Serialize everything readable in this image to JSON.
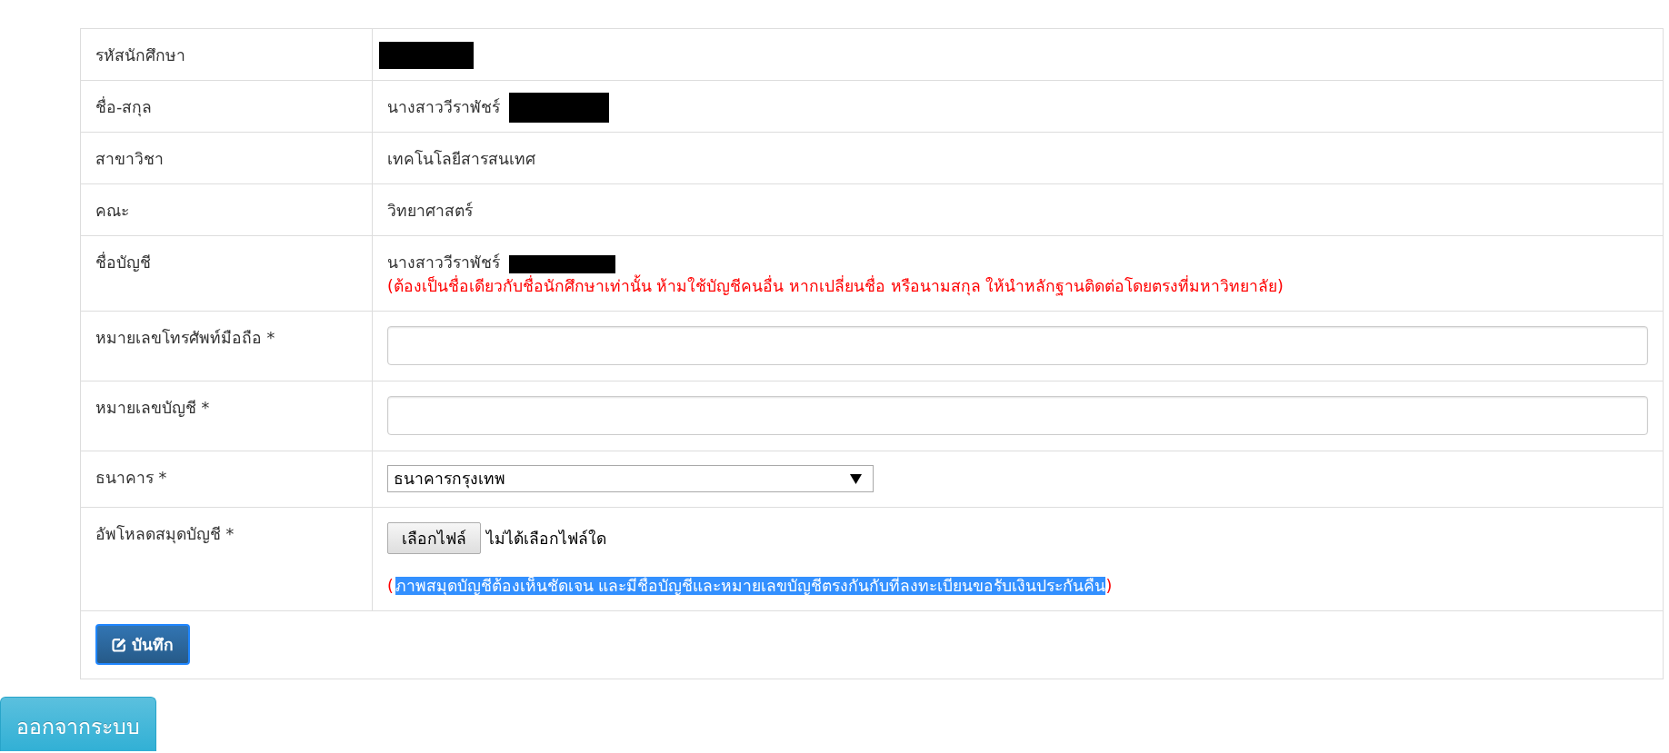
{
  "form": {
    "rows": [
      {
        "kind": "text",
        "label": "รหัสนักศึกษา",
        "redacted": true
      },
      {
        "kind": "text",
        "label": "ชื่อ-สกุล",
        "value": "นางสาววีราพัชร์",
        "redacted": true
      },
      {
        "kind": "text",
        "label": "สาขาวิชา",
        "value": "เทคโนโลยีสารสนเทศ",
        "redacted": false
      },
      {
        "kind": "text",
        "label": "คณะ",
        "value": "วิทยาศาสตร์",
        "redacted": false
      },
      {
        "kind": "text",
        "label": "ชื่อบัญชี",
        "value": "นางสาววีราพัชร์",
        "redacted": true,
        "note": "(ต้องเป็นชื่อเดียวกับชื่อนักศึกษาเท่านั้น ห้ามใช้บัญชีคนอื่น หากเปลี่ยนชื่อ หรือนามสกุล ให้นำหลักฐานติดต่อโดยตรงที่มหาวิทยาลัย)"
      },
      {
        "kind": "input",
        "label": "หมายเลขโทรศัพท์มือถือ *"
      },
      {
        "kind": "input",
        "label": "หมายเลขบัญชี *"
      },
      {
        "kind": "select",
        "label": "ธนาคาร *",
        "value": "ธนาคารกรุงเทพ"
      },
      {
        "kind": "file",
        "label": "อัพโหลดสมุดบัญชี *",
        "button": "เลือกไฟล์",
        "status": "ไม่ได้เลือกไฟล์ใด",
        "note": {
          "prefix": "(",
          "text": "ภาพสมุดบัญชีต้องเห็นชัดเจน และมีชื่อบัญชีและหมายเลขบัญชีตรงกันกับที่ลงทะเบียนขอรับเงินประกันคืน",
          "suffix": ")",
          "selected": true
        }
      },
      {
        "kind": "submit",
        "button": "บันทึก",
        "focused": true
      }
    ]
  },
  "logout_button": "ออกจากระบบ"
}
